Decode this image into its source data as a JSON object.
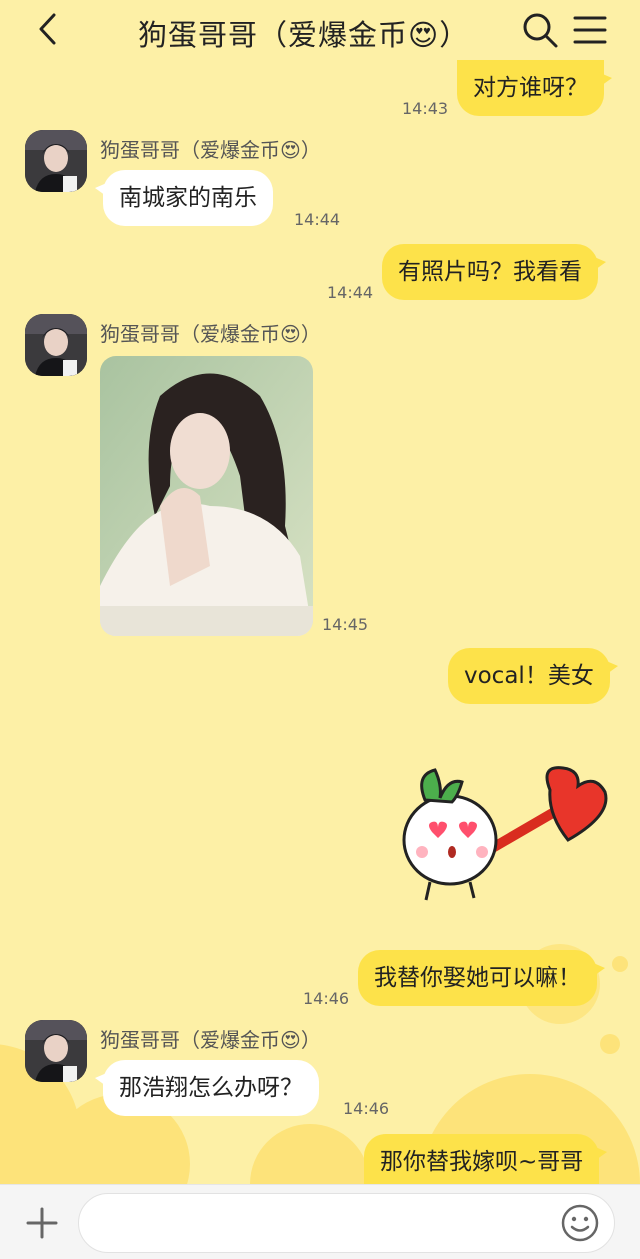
{
  "header": {
    "title": "狗蛋哥哥（爱爆金币😍）"
  },
  "contact": {
    "name": "狗蛋哥哥（爱爆金币😍）"
  },
  "messages": [
    {
      "text": "对方谁呀？",
      "time": "14:43"
    },
    {
      "text": "南城家的南乐",
      "time": "14:44"
    },
    {
      "text": "有照片吗？我看看",
      "time": "14:44"
    },
    {
      "time": "14:45"
    },
    {
      "text": "vocal！美女"
    },
    {
      "text": "我替你娶她可以嘛！",
      "time": "14:46"
    },
    {
      "text": "那浩翔怎么办呀？",
      "time": "14:46"
    },
    {
      "text": "那你替我嫁呗~哥哥"
    }
  ],
  "colors": {
    "background": "#fdf0a6",
    "outgoing_bubble": "#fde24a",
    "incoming_bubble": "#ffffff"
  },
  "icons": {
    "back": "back-icon",
    "search": "search-icon",
    "menu": "menu-icon",
    "plus": "plus-icon",
    "emoji": "emoji-icon"
  }
}
